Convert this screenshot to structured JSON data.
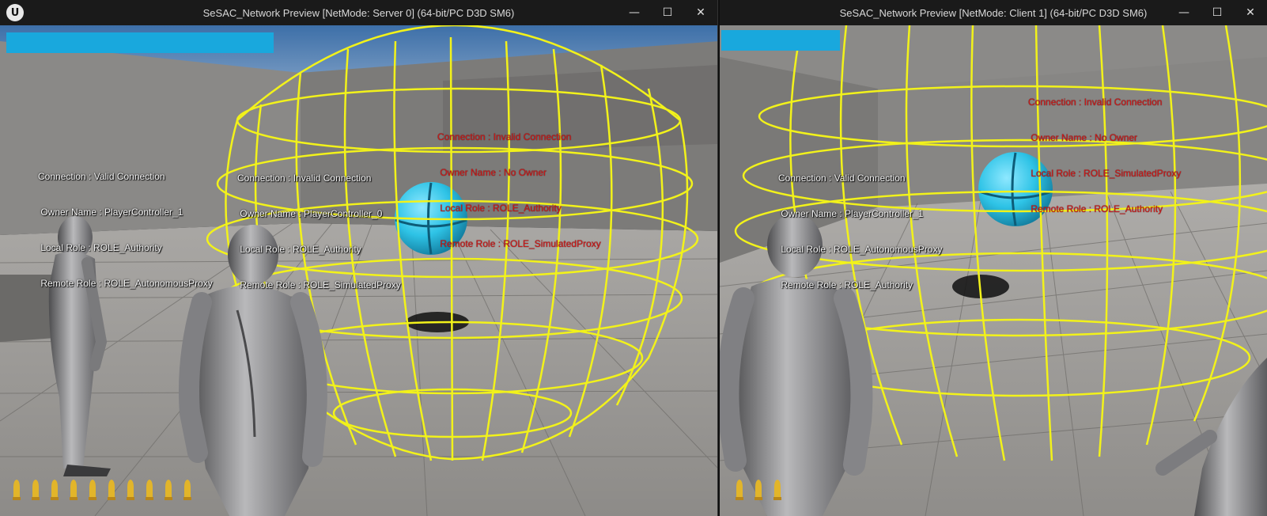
{
  "windows": [
    {
      "title": "SeSAC_Network Preview [NetMode: Server 0]  (64-bit/PC D3D SM6)",
      "controls": [
        "—",
        "☐",
        "✕"
      ],
      "labels": [
        [
          "Connection : Valid Connection",
          " Owner Name : PlayerController_1",
          " Local Role : ROLE_Authority",
          " Remote Role : ROLE_AutonomousProxy"
        ],
        [
          "Connection : Invalid Connection",
          " Owner Name : PlayerController_0",
          " Local Role : ROLE_Authority",
          " Remote Role : ROLE_SimulatedProxy"
        ],
        [
          "Connection : Invalid Connection",
          " Owner Name : No Owner",
          " Local Role : ROLE_Authority",
          " Remote Role : ROLE_SimulatedProxy"
        ]
      ],
      "ammo_count": 10
    },
    {
      "title": "SeSAC_Network Preview [NetMode: Client 1]  (64-bit/PC D3D SM6)",
      "controls": [
        "—",
        "☐",
        "✕"
      ],
      "labels": [
        [
          "Connection : Valid Connection",
          " Owner Name : PlayerController_1",
          " Local Role : ROLE_AutonomousProxy",
          " Remote Role : ROLE_Authority"
        ],
        [
          "Connection : Invalid Connection",
          " Owner Name : No Owner",
          " Local Role : ROLE_SimulatedProxy",
          " Remote Role : ROLE_Authority"
        ]
      ],
      "ammo_count": 3
    }
  ],
  "colors": {
    "hud_bar": "#19a8dd",
    "wireframe": "#f2f21a",
    "sphere": "#2ec3e6",
    "debug_white": "#f4f4f4",
    "debug_red": "#d01818"
  },
  "icons": {
    "engine_logo": "unreal-logo-icon",
    "bullet": "bullet-icon"
  },
  "logo_text": "U"
}
